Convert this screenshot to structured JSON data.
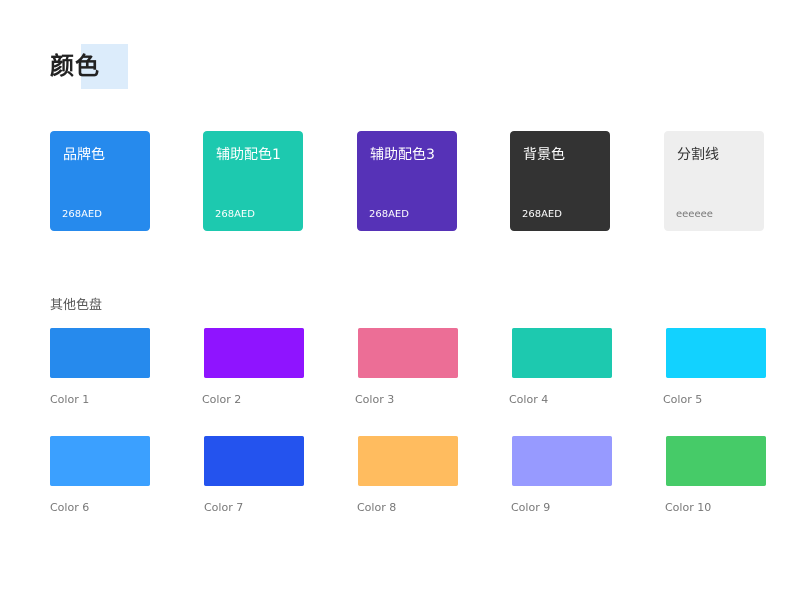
{
  "page": {
    "title": "颜色"
  },
  "main_colors": [
    {
      "name": "品牌色",
      "value": "268AED",
      "color": "#268AED",
      "text_color": "#ffffff",
      "hex_color": "#ffffff"
    },
    {
      "name": "辅助配色1",
      "value": "268AED",
      "color": "#1DC9AF",
      "text_color": "#ffffff",
      "hex_color": "#ffffff"
    },
    {
      "name": "辅助配色3",
      "value": "268AED",
      "color": "#5632B7",
      "text_color": "#ffffff",
      "hex_color": "#ffffff"
    },
    {
      "name": "背景色",
      "value": "268AED",
      "color": "#333333",
      "text_color": "#ffffff",
      "hex_color": "#ffffff"
    },
    {
      "name": "分割线",
      "value": "eeeeee",
      "color": "#EEEEEE",
      "text_color": "#333333",
      "hex_color": "#777777"
    }
  ],
  "palette": {
    "label": "其他色盘",
    "rows": [
      [
        {
          "label": "Color 1",
          "color": "#268AED"
        },
        {
          "label": "Color 2",
          "color": "#8F14FF"
        },
        {
          "label": "Color 3",
          "color": "#EC6E96"
        },
        {
          "label": "Color 4",
          "color": "#1DC9AF"
        },
        {
          "label": "Color 5",
          "color": "#12D2FF"
        }
      ],
      [
        {
          "label": "Color 6",
          "color": "#3BA0FF"
        },
        {
          "label": "Color 7",
          "color": "#2453EE"
        },
        {
          "label": "Color 8",
          "color": "#FFBC5F"
        },
        {
          "label": "Color 9",
          "color": "#979AFF"
        },
        {
          "label": "Color 10",
          "color": "#46CB68"
        }
      ]
    ]
  }
}
